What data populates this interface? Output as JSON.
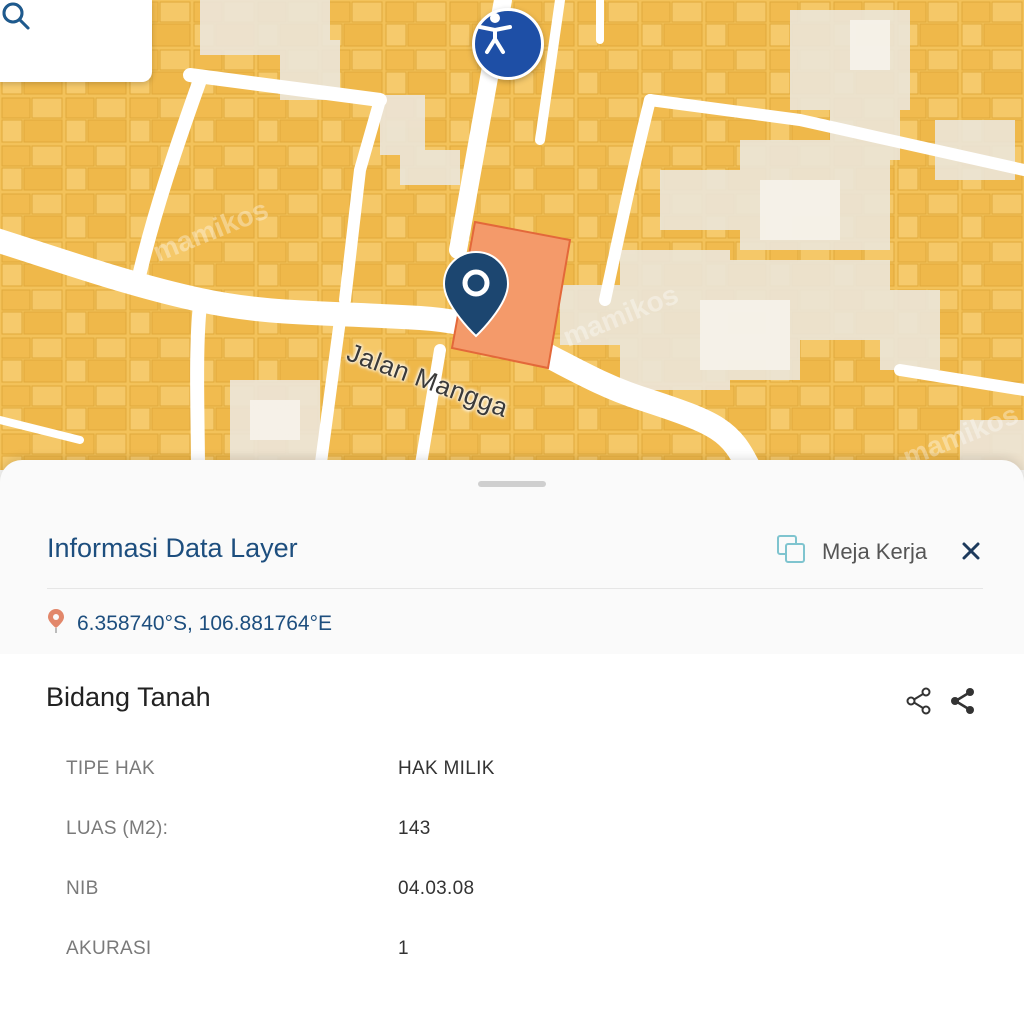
{
  "map": {
    "street_name": "Jalan Mangga",
    "watermark": "mamikos"
  },
  "search": {
    "icons": [
      "search-icon",
      "search-icon"
    ]
  },
  "accessibility": {
    "icon": "accessibility-icon"
  },
  "panel": {
    "title": "Informasi Data Layer",
    "workspace_label": "Meja Kerja",
    "coordinates": "6.358740°S, 106.881764°E"
  },
  "section": {
    "title": "Bidang Tanah",
    "rows": [
      {
        "key": "TIPE HAK",
        "value": "HAK MILIK"
      },
      {
        "key": "LUAS (M2):",
        "value": "143"
      },
      {
        "key": "NIB",
        "value": "04.03.08"
      },
      {
        "key": "AKURASI",
        "value": "1"
      }
    ]
  },
  "colors": {
    "parcel_fill": "#f3c25a",
    "selected_parcel": "#f49a6a",
    "accent": "#1d4e7e",
    "pin": "#1c4670",
    "accessibility": "#1e4fa6"
  }
}
